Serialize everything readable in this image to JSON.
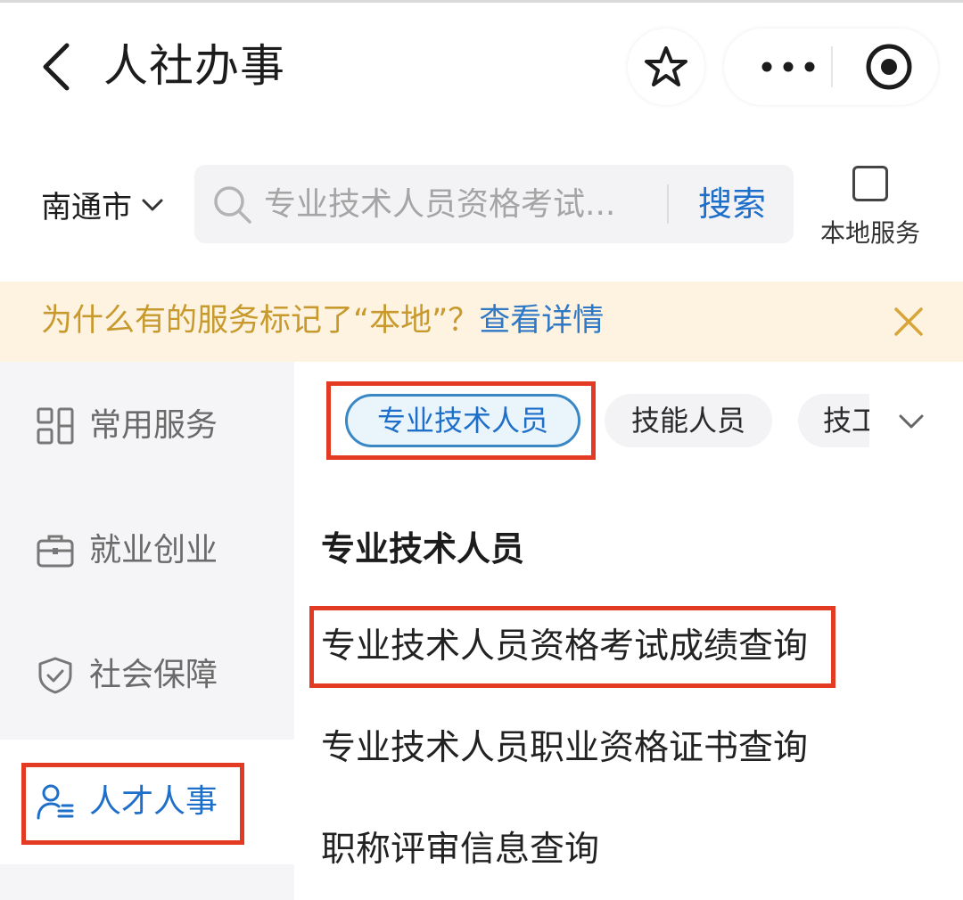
{
  "header": {
    "title": "人社办事",
    "icons": [
      "back-icon",
      "star-icon",
      "more-icon",
      "record-icon"
    ]
  },
  "search": {
    "city": "南通市",
    "placeholder": "专业技术人员资格考试...",
    "button": "搜索",
    "local_service_label": "本地服务"
  },
  "notice": {
    "text": "为什么有的服务标记了“本地”？",
    "link": "查看详情"
  },
  "sidebar": {
    "items": [
      {
        "label": "常用服务",
        "icon": "grid-icon",
        "active": false
      },
      {
        "label": "就业创业",
        "icon": "briefcase-icon",
        "active": false
      },
      {
        "label": "社会保障",
        "icon": "shield-icon",
        "active": false
      },
      {
        "label": "人才人事",
        "icon": "user-list-icon",
        "active": true
      }
    ]
  },
  "chips": [
    "专业技术人员",
    "技能人员",
    "技工"
  ],
  "content": {
    "section_title": "专业技术人员",
    "items": [
      "专业技术人员资格考试成绩查询",
      "专业技术人员职业资格证书查询",
      "职称评审信息查询"
    ]
  },
  "colors": {
    "accent_blue": "#1e6fc9",
    "highlight_red": "#e23a23",
    "notice_bg": "#fdf3e0",
    "notice_text": "#c89a2e"
  }
}
